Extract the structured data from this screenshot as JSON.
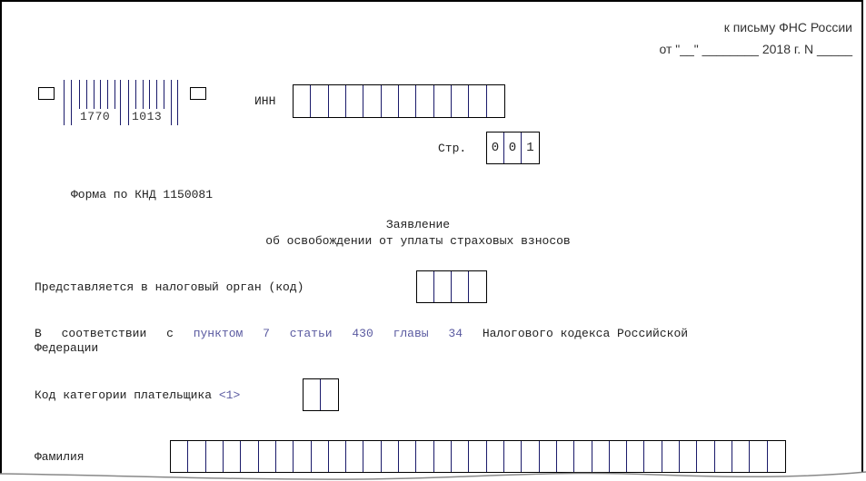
{
  "header": {
    "letter_ref": "к письму ФНС России",
    "date_line": "от \"__\" ________ 2018 г. N _____"
  },
  "barcode": {
    "digits_left": "1770",
    "digits_right": "1013"
  },
  "inn": {
    "label": "ИНН",
    "cells": [
      "",
      "",
      "",
      "",
      "",
      "",
      "",
      "",
      "",
      "",
      "",
      ""
    ]
  },
  "page_num": {
    "label": "Стр.",
    "cells": [
      "0",
      "0",
      "1"
    ]
  },
  "form": {
    "knd_label": "Форма по КНД 1150081",
    "title_line1": "Заявление",
    "title_line2": "об освобождении от уплаты страховых взносов"
  },
  "tax_authority": {
    "label": "Представляется в налоговый орган (код)",
    "cells": [
      "",
      "",
      "",
      ""
    ]
  },
  "legal_basis": {
    "word_v": "В",
    "word_sootv": "соответствии",
    "word_s": "с",
    "link_punkt": "пунктом",
    "link_punkt_num": "7",
    "link_statya": "статьи",
    "link_statya_num": "430",
    "link_glava": "главы",
    "link_glava_num": "34",
    "tail": "Налогового кодекса Российской",
    "line2": "Федерации"
  },
  "payer_category": {
    "label": "Код категории плательщика",
    "footnote": "<1>",
    "cells": [
      "",
      ""
    ]
  },
  "surname": {
    "label": "Фамилия",
    "cells": [
      "",
      "",
      "",
      "",
      "",
      "",
      "",
      "",
      "",
      "",
      "",
      "",
      "",
      "",
      "",
      "",
      "",
      "",
      "",
      "",
      "",
      "",
      "",
      "",
      "",
      "",
      "",
      "",
      "",
      "",
      "",
      "",
      "",
      "",
      ""
    ]
  },
  "colors": {
    "link": "#5a5aa0",
    "text": "#222222",
    "border": "#000000"
  }
}
